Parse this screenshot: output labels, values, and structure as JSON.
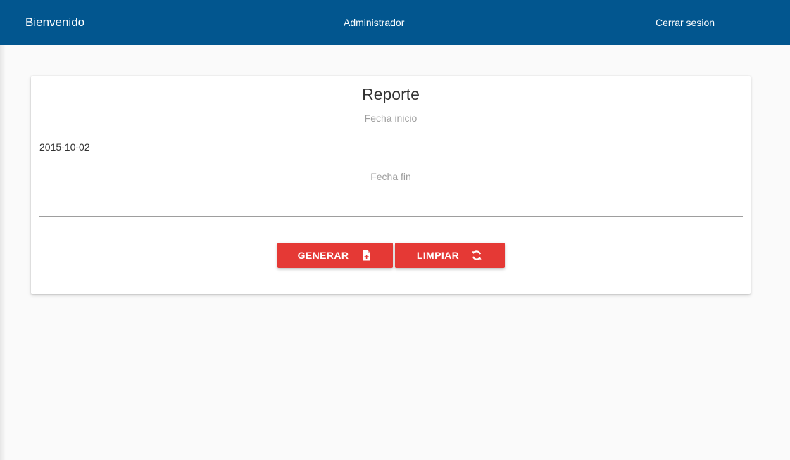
{
  "navbar": {
    "brand": "Bienvenido",
    "user": "Administrador",
    "logout": "Cerrar sesion",
    "color": "#02568f"
  },
  "report": {
    "title": "Reporte",
    "start_label": "Fecha inicio",
    "start_value": "2015-10-02",
    "end_label": "Fecha fin",
    "end_value": ""
  },
  "actions": {
    "generate_label": "GENERAR",
    "generate_icon": "file-plus-icon",
    "clear_label": "LIMPIAR",
    "clear_icon": "refresh-icon",
    "color": "#e53935"
  }
}
